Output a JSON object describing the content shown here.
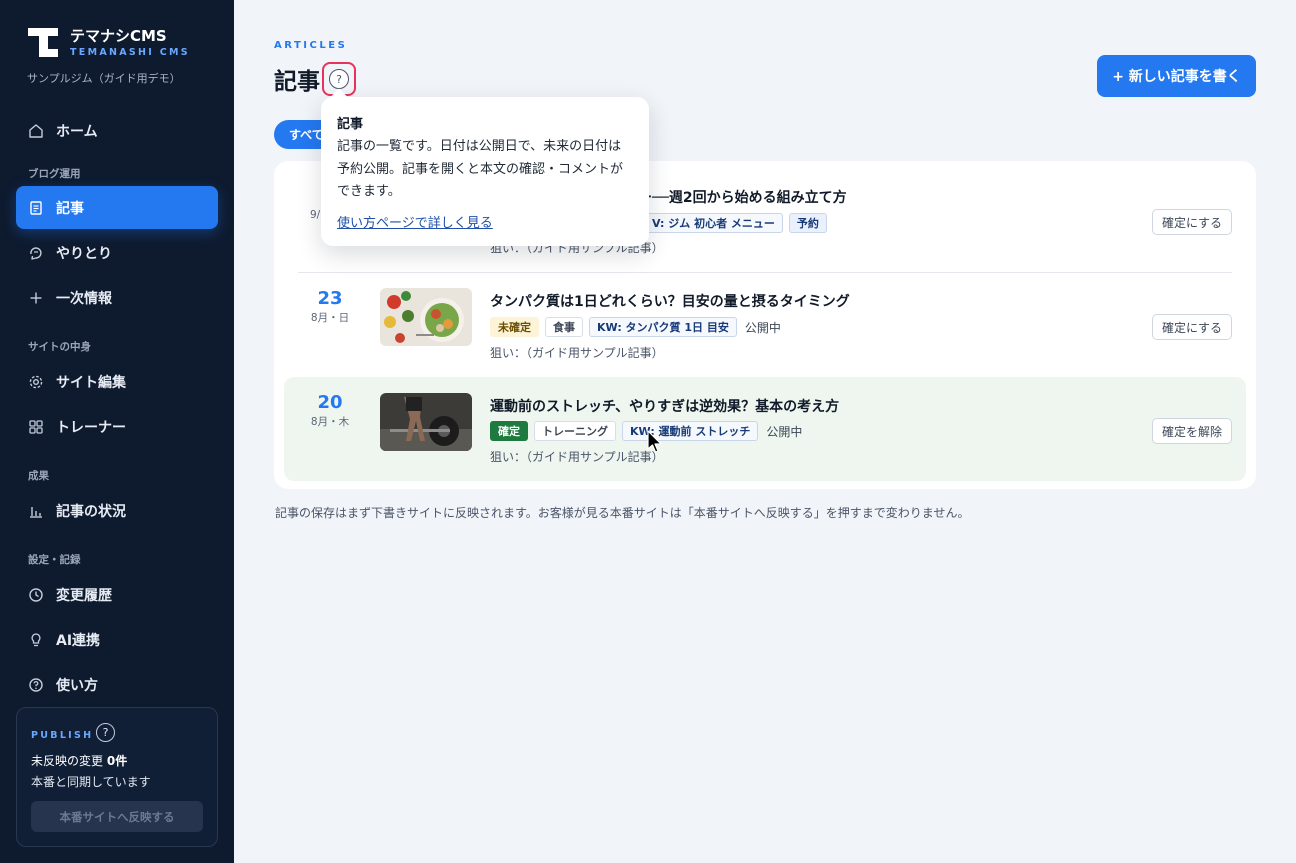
{
  "sidebar": {
    "logo_title": "テマナシCMS",
    "logo_sub": "TEMANASHI CMS",
    "site_name": "サンプルジム（ガイド用デモ）",
    "home": "ホーム",
    "sections": {
      "blog": "ブログ運用",
      "site": "サイトの中身",
      "results": "成果",
      "settings": "設定・記録"
    },
    "items": {
      "articles": "記事",
      "exchanges": "やりとり",
      "primary_info": "一次情報",
      "site_edit": "サイト編集",
      "trainers": "トレーナー",
      "article_status": "記事の状況",
      "history": "変更履歴",
      "ai": "AI連携",
      "howto": "使い方"
    },
    "publish": {
      "label": "PUBLISH",
      "help": "?",
      "pending_prefix": "未反映の変更",
      "pending_count": "0件",
      "synced": "本番と同期しています",
      "button": "本番サイトへ反映する"
    }
  },
  "header": {
    "eyebrow": "ARTICLES",
    "title": "記事",
    "help": "?",
    "new_button": "+ 新しい記事を書く"
  },
  "filters": {
    "all": "すべて"
  },
  "articles": [
    {
      "day": "",
      "date_sub": "9/",
      "title": "ー──週2回から始める組み立て方",
      "tags": [],
      "keyword": "V: ジム 初心者 メニュー",
      "scheduled": "予約",
      "status": "",
      "aim": "狙い：（ガイド用サンプル記事）",
      "button": "確定にする"
    },
    {
      "day": "23",
      "date_sub": "8月・日",
      "title": "タンパク質は1日どれくらい？目安の量と摂るタイミング",
      "state_tag": "未確定",
      "category": "食事",
      "keyword": "KW: タンパク質 1日 目安",
      "status": "公開中",
      "aim": "狙い：（ガイド用サンプル記事）",
      "button": "確定にする"
    },
    {
      "day": "20",
      "date_sub": "8月・木",
      "title": "運動前のストレッチ、やりすぎは逆効果？基本の考え方",
      "state_tag": "確定",
      "category": "トレーニング",
      "keyword": "KW: 運動前 ストレッチ",
      "status": "公開中",
      "aim": "狙い：（ガイド用サンプル記事）",
      "button": "確定を解除"
    }
  ],
  "footnote": "記事の保存はまず下書きサイトに反映されます。お客様が見る本番サイトは「本番サイトへ反映する」を押すまで変わりません。",
  "tooltip": {
    "title": "記事",
    "body": "記事の一覧です。日付は公開日で、未来の日付は予約公開。記事を開くと本文の確認・コメントができます。",
    "link": "使い方ページで詳しく見る"
  },
  "colors": {
    "accent": "#2478f0",
    "sidebar_bg": "#0e1a2e",
    "confirmed_bg": "#eef6ef",
    "confirmed_tag": "#1f7a3f",
    "pending_tag": "#fdf3d6",
    "focus_ring": "#e8335a"
  }
}
